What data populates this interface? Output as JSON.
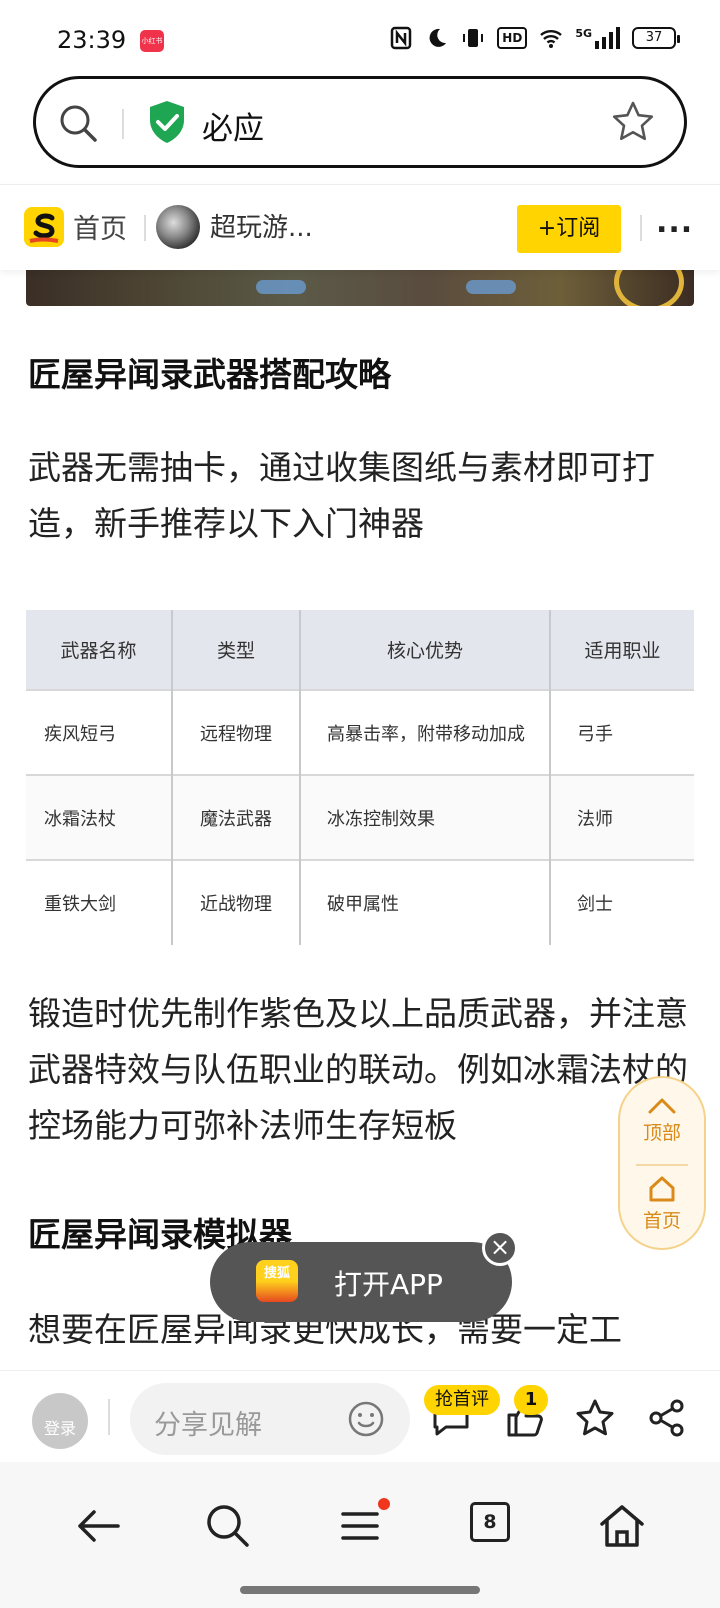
{
  "status_bar": {
    "time": "23:39",
    "app_badge": "小红书",
    "network": "5G",
    "hd": "HD",
    "battery": "37"
  },
  "search": {
    "query": "必应"
  },
  "site_nav": {
    "home_label": "首页",
    "author": "超玩游...",
    "subscribe_label": "+订阅",
    "more": "..."
  },
  "article": {
    "heading1": "匠屋异闻录武器搭配攻略",
    "para1": "武器无需抽卡，通过收集图纸与素材即可打造，新手推荐以下入门神器",
    "table": {
      "headers": [
        "武器名称",
        "类型",
        "核心优势",
        "适用职业"
      ],
      "rows": [
        [
          "疾风短弓",
          "远程物理",
          "高暴击率，附带移动加成",
          "弓手"
        ],
        [
          "冰霜法杖",
          "魔法武器",
          "冰冻控制效果",
          "法师"
        ],
        [
          "重铁大剑",
          "近战物理",
          "破甲属性",
          "剑士"
        ]
      ]
    },
    "para2": "锻造时优先制作紫色及以上品质武器，并注意武器特效与队伍职业的联动。例如冰霜法杖的控场能力可弥补法师生存短板",
    "heading2": "匠屋异闻录模拟器",
    "para3": "想要在匠屋异闻录更快成长，需要一定工"
  },
  "side_pill": {
    "top_label": "顶部",
    "home_label": "首页"
  },
  "open_app": {
    "logo_text": "搜狐",
    "label": "打开APP",
    "close": "×"
  },
  "comment_bar": {
    "login_label": "登录",
    "placeholder": "分享见解",
    "first_review_badge": "抢首评",
    "like_count": "1"
  },
  "bottom_nav": {
    "tab_count": "8"
  },
  "colors": {
    "accent_yellow": "#ffd400",
    "pill_orange": "#d98a18",
    "shield_green": "#1fa652",
    "notify_red": "#f0371e"
  }
}
